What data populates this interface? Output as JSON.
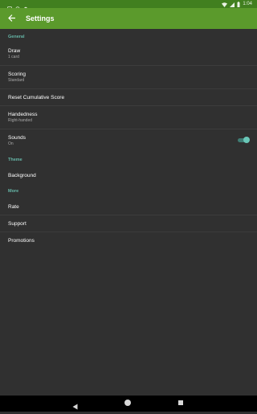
{
  "status_bar": {
    "time": "1:04",
    "icons": [
      "notification-icon",
      "sync-icon",
      "circle-icon",
      "wifi-icon",
      "signal-icon",
      "battery-icon"
    ]
  },
  "app_bar": {
    "title": "Settings",
    "back_icon": "arrow-back-icon",
    "color": "#5b9a2c"
  },
  "sections": {
    "general": {
      "header": "General",
      "draw": {
        "title": "Draw",
        "summary": "1 card"
      },
      "scoring": {
        "title": "Scoring",
        "summary": "Standard"
      },
      "reset": {
        "title": "Reset Cumulative Score"
      },
      "handedness": {
        "title": "Handedness",
        "summary": "Right-handed"
      },
      "sounds": {
        "title": "Sounds",
        "summary": "On",
        "enabled": true
      }
    },
    "theme": {
      "header": "Theme",
      "background": {
        "title": "Background"
      }
    },
    "more": {
      "header": "More",
      "rate": {
        "title": "Rate"
      },
      "support": {
        "title": "Support"
      },
      "promotions": {
        "title": "Promotions"
      }
    }
  },
  "accent_color": "#66b7a8",
  "nav_bar": {
    "icons": [
      "back-triangle-icon",
      "home-circle-icon",
      "recents-square-icon"
    ]
  }
}
